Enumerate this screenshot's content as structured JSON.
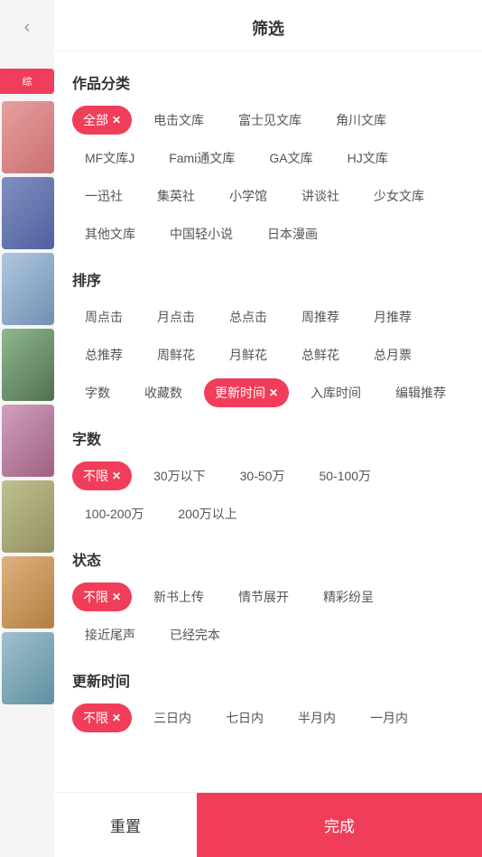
{
  "header": {
    "title": "筛选",
    "back_icon": "‹"
  },
  "sections": {
    "category": {
      "title": "作品分类",
      "tags": [
        {
          "label": "全部",
          "active": true
        },
        {
          "label": "电击文库",
          "active": false
        },
        {
          "label": "富士见文库",
          "active": false
        },
        {
          "label": "角川文库",
          "active": false
        },
        {
          "label": "MF文库J",
          "active": false
        },
        {
          "label": "Fami通文库",
          "active": false
        },
        {
          "label": "GA文库",
          "active": false
        },
        {
          "label": "HJ文库",
          "active": false
        },
        {
          "label": "一迅社",
          "active": false
        },
        {
          "label": "集英社",
          "active": false
        },
        {
          "label": "小学馆",
          "active": false
        },
        {
          "label": "讲谈社",
          "active": false
        },
        {
          "label": "少女文库",
          "active": false
        },
        {
          "label": "其他文库",
          "active": false
        },
        {
          "label": "中国轻小说",
          "active": false
        },
        {
          "label": "日本漫画",
          "active": false
        }
      ]
    },
    "sort": {
      "title": "排序",
      "tags": [
        {
          "label": "周点击",
          "active": false
        },
        {
          "label": "月点击",
          "active": false
        },
        {
          "label": "总点击",
          "active": false
        },
        {
          "label": "周推荐",
          "active": false
        },
        {
          "label": "月推荐",
          "active": false
        },
        {
          "label": "总推荐",
          "active": false
        },
        {
          "label": "周鲜花",
          "active": false
        },
        {
          "label": "月鲜花",
          "active": false
        },
        {
          "label": "总鲜花",
          "active": false
        },
        {
          "label": "总月票",
          "active": false
        },
        {
          "label": "字数",
          "active": false
        },
        {
          "label": "收藏数",
          "active": false
        },
        {
          "label": "更新时间",
          "active": true
        },
        {
          "label": "入库时间",
          "active": false
        },
        {
          "label": "编辑推荐",
          "active": false
        }
      ]
    },
    "word_count": {
      "title": "字数",
      "tags": [
        {
          "label": "不限",
          "active": true
        },
        {
          "label": "30万以下",
          "active": false
        },
        {
          "label": "30-50万",
          "active": false
        },
        {
          "label": "50-100万",
          "active": false
        },
        {
          "label": "100-200万",
          "active": false
        },
        {
          "label": "200万以上",
          "active": false
        }
      ]
    },
    "status": {
      "title": "状态",
      "tags": [
        {
          "label": "不限",
          "active": true
        },
        {
          "label": "新书上传",
          "active": false
        },
        {
          "label": "情节展开",
          "active": false
        },
        {
          "label": "精彩纷呈",
          "active": false
        },
        {
          "label": "接近尾声",
          "active": false
        },
        {
          "label": "已经完本",
          "active": false
        }
      ]
    },
    "update_time": {
      "title": "更新时间",
      "tags": [
        {
          "label": "不限",
          "active": true
        },
        {
          "label": "三日内",
          "active": false
        },
        {
          "label": "七日内",
          "active": false
        },
        {
          "label": "半月内",
          "active": false
        },
        {
          "label": "一月内",
          "active": false
        }
      ]
    }
  },
  "footer": {
    "reset_label": "重置",
    "confirm_label": "完成"
  },
  "sidebar": {
    "active_tab": "综"
  }
}
